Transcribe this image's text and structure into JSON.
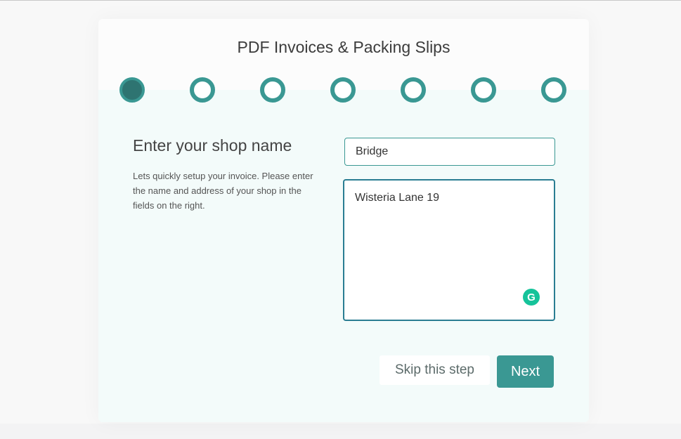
{
  "wizard": {
    "title": "PDF Invoices & Packing Slips",
    "steps": [
      {
        "index": 1,
        "state": "active"
      },
      {
        "index": 2,
        "state": "inactive"
      },
      {
        "index": 3,
        "state": "inactive"
      },
      {
        "index": 4,
        "state": "inactive"
      },
      {
        "index": 5,
        "state": "inactive"
      },
      {
        "index": 6,
        "state": "inactive"
      },
      {
        "index": 7,
        "state": "inactive"
      }
    ],
    "current_step": 1,
    "total_steps": 7
  },
  "step_content": {
    "heading": "Enter your shop name",
    "description": "Lets quickly setup your invoice. Please enter the name and address of your shop in the fields on the right."
  },
  "form": {
    "shop_name_value": "Bridge",
    "shop_address_value": "Wisteria Lane 19 ",
    "grammarly_icon": "G"
  },
  "actions": {
    "skip_label": "Skip this step",
    "next_label": "Next"
  },
  "colors": {
    "accent": "#3a9893",
    "active_step": "#2e7471",
    "grammarly": "#15c39a"
  }
}
